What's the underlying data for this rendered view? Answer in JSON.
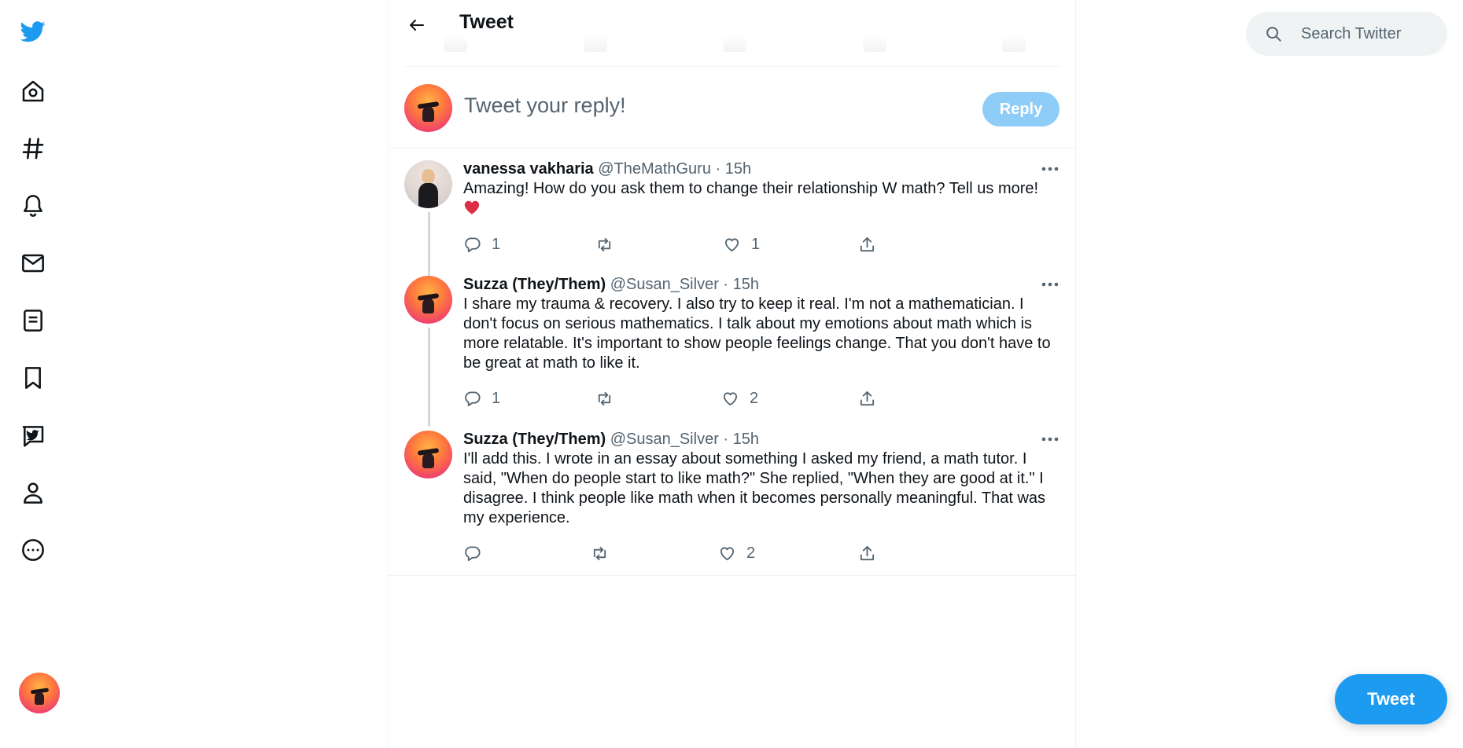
{
  "colors": {
    "brand": "#1d9bf0",
    "reply_button_disabled": "#8ecdf8",
    "secondary_text": "#536471",
    "divider": "#eff3f4",
    "thread_line": "#cfd9de"
  },
  "nav": {
    "items": [
      {
        "icon": "twitter-logo-icon"
      },
      {
        "icon": "home-icon"
      },
      {
        "icon": "explore-hashtag-icon"
      },
      {
        "icon": "notifications-bell-icon"
      },
      {
        "icon": "messages-envelope-icon"
      },
      {
        "icon": "lists-icon"
      },
      {
        "icon": "bookmarks-icon"
      },
      {
        "icon": "twitter-blue-icon"
      },
      {
        "icon": "profile-icon"
      },
      {
        "icon": "more-circle-icon"
      }
    ]
  },
  "header": {
    "title": "Tweet"
  },
  "composer": {
    "placeholder": "Tweet your reply!",
    "reply_label": "Reply"
  },
  "replies": [
    {
      "name": "vanessa vakharia",
      "meta": "@TheMathGuru · 15h",
      "text": "Amazing! How do you ask them to change their relationship W math? Tell us more!",
      "has_heart_emoji": true,
      "replies_count": "1",
      "retweets_count": "",
      "likes_count": "1"
    },
    {
      "name": "Suzza (They/Them)",
      "meta": "@Susan_Silver · 15h",
      "text": "I share my trauma & recovery. I also try to keep it real. I'm not a mathematician. I don't focus on serious mathematics. I talk about my emotions about math which is more relatable. It's important to show people feelings change. That you don't have to be great at math to like it.",
      "replies_count": "1",
      "retweets_count": "",
      "likes_count": "2"
    },
    {
      "name": "Suzza (They/Them)",
      "meta": "@Susan_Silver · 15h",
      "text": "I'll add this. I wrote in an essay about something I asked my friend, a math tutor. I said, \"When do people start to like math?\" She replied, \"When they are good at it.\" I disagree. I think people like math when it becomes personally meaningful. That was my experience.",
      "replies_count": "",
      "retweets_count": "",
      "likes_count": "2"
    }
  ],
  "search": {
    "placeholder": "Search Twitter"
  },
  "tweet_button": {
    "label": "Tweet"
  }
}
